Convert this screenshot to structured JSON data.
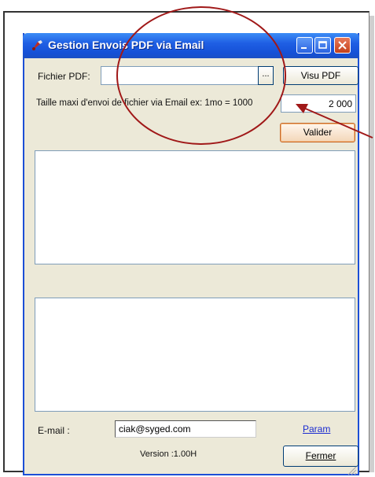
{
  "window": {
    "title": "Gestion Envois PDF via Email"
  },
  "pdf": {
    "label": "Fichier PDF:",
    "value": "",
    "browse_label": "...",
    "view_button": "Visu PDF"
  },
  "size": {
    "label": "Taille maxi d'envoi de fichier via Email ex: 1mo = 1000",
    "value": "2 000"
  },
  "validate_button": "Valider",
  "email": {
    "label": "E-mail :",
    "value": "ciak@syged.com",
    "param_link": "Param"
  },
  "version": "Version :1.00H",
  "close_button": "Fermer",
  "annotation": {
    "color": "#a01818"
  },
  "colors": {
    "titlebar": "#1f5fe4",
    "window_bg": "#ece9d8",
    "link": "#1a2bd0"
  }
}
